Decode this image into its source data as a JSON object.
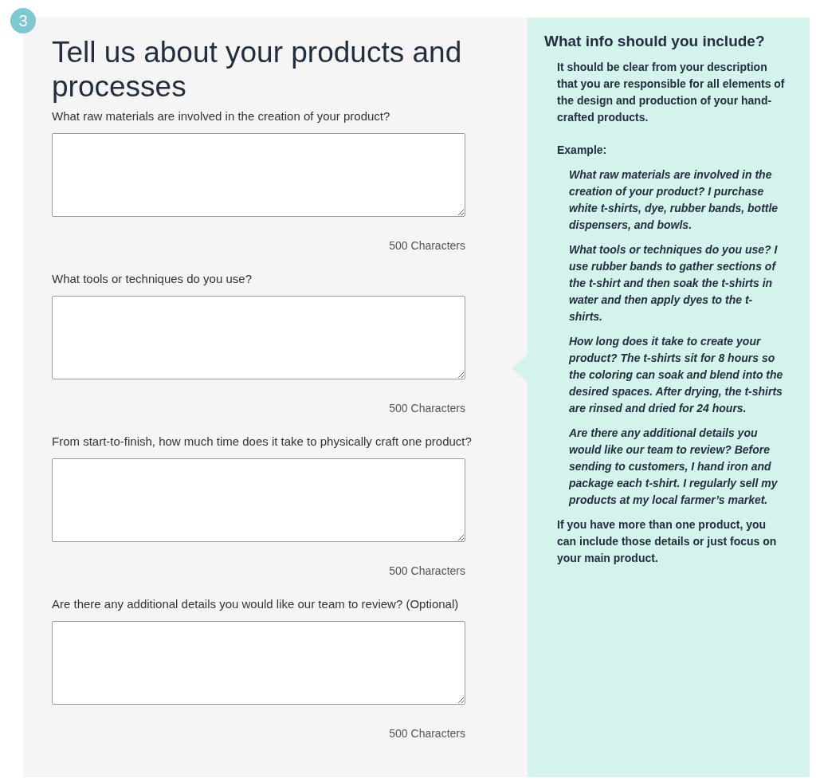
{
  "step": {
    "number": "3"
  },
  "form": {
    "title": "Tell us about your products and processes",
    "questions": [
      {
        "label": "What raw materials are involved in the creation of your product?",
        "counter": "500 Characters"
      },
      {
        "label": "What tools or techniques do you use?",
        "counter": "500 Characters"
      },
      {
        "label": "From start-to-finish, how much time does it take to physically craft one product?",
        "counter": "500 Characters"
      },
      {
        "label": "Are there any additional details you would like our team to review? (Optional)",
        "counter": "500 Characters"
      }
    ]
  },
  "info_panel": {
    "title": "What info should you include?",
    "intro": "It should be clear from your description that you are responsible for all elements of the design and production of your hand-crafted products.",
    "example_label": "Example:",
    "examples": [
      "What raw materials are involved in the creation of your product? I purchase white t-shirts, dye, rubber bands, bottle dispensers, and bowls.",
      "What tools or techniques do you use? I use rubber bands to gather sections of the t-shirt and then soak the t-shirts in water and then apply dyes to the t-shirts.",
      "How long does it take to create your product? The t-shirts sit for 8 hours so the coloring can soak and blend into the desired spaces. After drying, the t-shirts are rinsed and dried for 24 hours.",
      "Are there any additional details you would like our team to review? Before sending to customers, I hand iron and package each t-shirt. I regularly sell my products at my local farmer’s market."
    ],
    "closing": "If you have more than one product, you can include those details or just focus on your main product."
  }
}
